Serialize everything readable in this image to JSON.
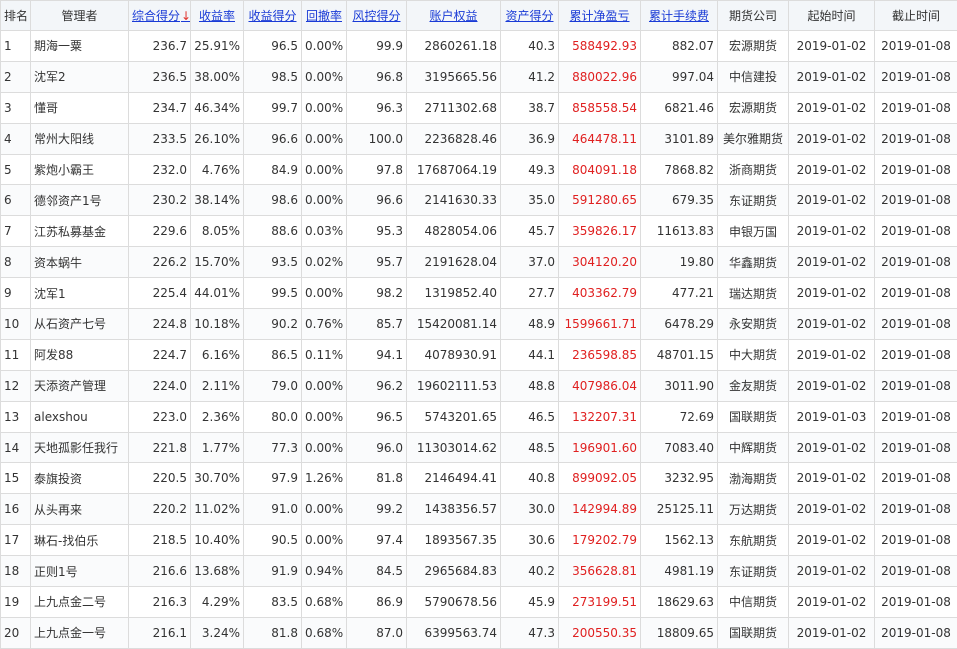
{
  "columns": [
    {
      "key": "rank",
      "label": "排名",
      "sortable": false
    },
    {
      "key": "manager",
      "label": "管理者",
      "sortable": false
    },
    {
      "key": "composite",
      "label": "综合得分",
      "sortable": true,
      "sorted": "desc",
      "arrow": "↓"
    },
    {
      "key": "return_rate",
      "label": "收益率",
      "sortable": true
    },
    {
      "key": "return_score",
      "label": "收益得分",
      "sortable": true
    },
    {
      "key": "drawdown",
      "label": "回撤率",
      "sortable": true
    },
    {
      "key": "risk_score",
      "label": "风控得分",
      "sortable": true
    },
    {
      "key": "equity",
      "label": "账户权益",
      "sortable": true
    },
    {
      "key": "asset_score",
      "label": "资产得分",
      "sortable": true
    },
    {
      "key": "net_profit",
      "label": "累计净盈亏",
      "sortable": true
    },
    {
      "key": "fees",
      "label": "累计手续费",
      "sortable": true
    },
    {
      "key": "company",
      "label": "期货公司",
      "sortable": false
    },
    {
      "key": "start",
      "label": "起始时间",
      "sortable": false
    },
    {
      "key": "end",
      "label": "截止时间",
      "sortable": false
    }
  ],
  "colors": {
    "profit": "#e02020",
    "link": "#1a3bd6",
    "header_bg": "#f3f6f9",
    "border": "#dcdcdc"
  },
  "rows": [
    [
      "1",
      "期海一粟",
      "236.7",
      "25.91%",
      "96.5",
      "0.00%",
      "99.9",
      "2860261.18",
      "40.3",
      "588492.93",
      "882.07",
      "宏源期货",
      "2019-01-02",
      "2019-01-08"
    ],
    [
      "2",
      "沈军2",
      "236.5",
      "38.00%",
      "98.5",
      "0.00%",
      "96.8",
      "3195665.56",
      "41.2",
      "880022.96",
      "997.04",
      "中信建投",
      "2019-01-02",
      "2019-01-08"
    ],
    [
      "3",
      "懂哥",
      "234.7",
      "46.34%",
      "99.7",
      "0.00%",
      "96.3",
      "2711302.68",
      "38.7",
      "858558.54",
      "6821.46",
      "宏源期货",
      "2019-01-02",
      "2019-01-08"
    ],
    [
      "4",
      "常州大阳线",
      "233.5",
      "26.10%",
      "96.6",
      "0.00%",
      "100.0",
      "2236828.46",
      "36.9",
      "464478.11",
      "3101.89",
      "美尔雅期货",
      "2019-01-02",
      "2019-01-08"
    ],
    [
      "5",
      "紫炮小霸王",
      "232.0",
      "4.76%",
      "84.9",
      "0.00%",
      "97.8",
      "17687064.19",
      "49.3",
      "804091.18",
      "7868.82",
      "浙商期货",
      "2019-01-02",
      "2019-01-08"
    ],
    [
      "6",
      "德邻资产1号",
      "230.2",
      "38.14%",
      "98.6",
      "0.00%",
      "96.6",
      "2141630.33",
      "35.0",
      "591280.65",
      "679.35",
      "东证期货",
      "2019-01-02",
      "2019-01-08"
    ],
    [
      "7",
      "江苏私募基金",
      "229.6",
      "8.05%",
      "88.6",
      "0.03%",
      "95.3",
      "4828054.06",
      "45.7",
      "359826.17",
      "11613.83",
      "申银万国",
      "2019-01-02",
      "2019-01-08"
    ],
    [
      "8",
      "资本蜗牛",
      "226.2",
      "15.70%",
      "93.5",
      "0.02%",
      "95.7",
      "2191628.04",
      "37.0",
      "304120.20",
      "19.80",
      "华鑫期货",
      "2019-01-02",
      "2019-01-08"
    ],
    [
      "9",
      "沈军1",
      "225.4",
      "44.01%",
      "99.5",
      "0.00%",
      "98.2",
      "1319852.40",
      "27.7",
      "403362.79",
      "477.21",
      "瑞达期货",
      "2019-01-02",
      "2019-01-08"
    ],
    [
      "10",
      "从石资产七号",
      "224.8",
      "10.18%",
      "90.2",
      "0.76%",
      "85.7",
      "15420081.14",
      "48.9",
      "1599661.71",
      "6478.29",
      "永安期货",
      "2019-01-02",
      "2019-01-08"
    ],
    [
      "11",
      "阿发88",
      "224.7",
      "6.16%",
      "86.5",
      "0.11%",
      "94.1",
      "4078930.91",
      "44.1",
      "236598.85",
      "48701.15",
      "中大期货",
      "2019-01-02",
      "2019-01-08"
    ],
    [
      "12",
      "天添资产管理",
      "224.0",
      "2.11%",
      "79.0",
      "0.00%",
      "96.2",
      "19602111.53",
      "48.8",
      "407986.04",
      "3011.90",
      "金友期货",
      "2019-01-02",
      "2019-01-08"
    ],
    [
      "13",
      "alexshou",
      "223.0",
      "2.36%",
      "80.0",
      "0.00%",
      "96.5",
      "5743201.65",
      "46.5",
      "132207.31",
      "72.69",
      "国联期货",
      "2019-01-03",
      "2019-01-08"
    ],
    [
      "14",
      "天地孤影任我行",
      "221.8",
      "1.77%",
      "77.3",
      "0.00%",
      "96.0",
      "11303014.62",
      "48.5",
      "196901.60",
      "7083.40",
      "中辉期货",
      "2019-01-02",
      "2019-01-08"
    ],
    [
      "15",
      "泰旗投资",
      "220.5",
      "30.70%",
      "97.9",
      "1.26%",
      "81.8",
      "2146494.41",
      "40.8",
      "899092.05",
      "3232.95",
      "渤海期货",
      "2019-01-02",
      "2019-01-08"
    ],
    [
      "16",
      "从头再来",
      "220.2",
      "11.02%",
      "91.0",
      "0.00%",
      "99.2",
      "1438356.57",
      "30.0",
      "142994.89",
      "25125.11",
      "万达期货",
      "2019-01-02",
      "2019-01-08"
    ],
    [
      "17",
      "琳石-找伯乐",
      "218.5",
      "10.40%",
      "90.5",
      "0.00%",
      "97.4",
      "1893567.35",
      "30.6",
      "179202.79",
      "1562.13",
      "东航期货",
      "2019-01-02",
      "2019-01-08"
    ],
    [
      "18",
      "正则1号",
      "216.6",
      "13.68%",
      "91.9",
      "0.94%",
      "84.5",
      "2965684.83",
      "40.2",
      "356628.81",
      "4981.19",
      "东证期货",
      "2019-01-02",
      "2019-01-08"
    ],
    [
      "19",
      "上九点金二号",
      "216.3",
      "4.29%",
      "83.5",
      "0.68%",
      "86.9",
      "5790678.56",
      "45.9",
      "273199.51",
      "18629.63",
      "中信期货",
      "2019-01-02",
      "2019-01-08"
    ],
    [
      "20",
      "上九点金一号",
      "216.1",
      "3.24%",
      "81.8",
      "0.68%",
      "87.0",
      "6399563.74",
      "47.3",
      "200550.35",
      "18809.65",
      "国联期货",
      "2019-01-02",
      "2019-01-08"
    ]
  ]
}
